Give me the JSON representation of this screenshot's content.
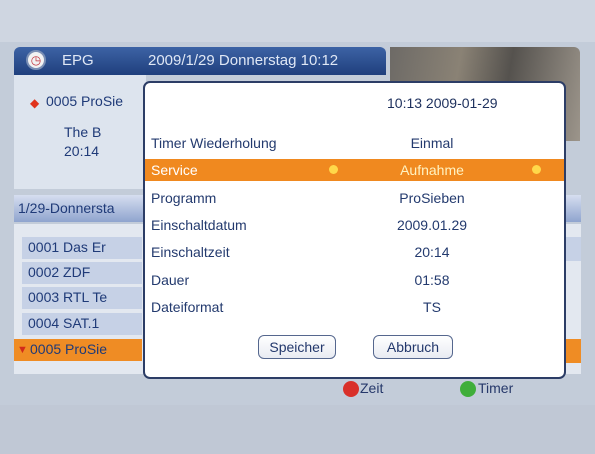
{
  "epg": {
    "title": "EPG",
    "datetime": "2009/1/29 Donnerstag 10:12",
    "icon": "clock-icon"
  },
  "info": {
    "channel": "0005 ProSie",
    "title": "The B",
    "time": "20:14"
  },
  "date_bar": {
    "label": "1/29-Donnersta"
  },
  "channels": [
    {
      "label": "0001 Das Er"
    },
    {
      "label": "0002 ZDF"
    },
    {
      "label": "0003 RTL Te"
    },
    {
      "label": "0004 SAT.1"
    },
    {
      "label": "0005 ProSie"
    }
  ],
  "selected_channel_index": 4,
  "legend": {
    "red_label": "Zeit",
    "green_label": "Timer",
    "red_color": "#d9302a",
    "green_color": "#3fae3a"
  },
  "dialog": {
    "clock": "10:13 2009-01-29",
    "rows": [
      {
        "label": "Timer Wiederholung",
        "value": "Einmal"
      },
      {
        "label": "Service",
        "value": "Aufnahme"
      },
      {
        "label": "Programm",
        "value": "ProSieben"
      },
      {
        "label": "Einschaltdatum",
        "value": "2009.01.29"
      },
      {
        "label": "Einschaltzeit",
        "value": "20:14"
      },
      {
        "label": "Dauer",
        "value": "01:58"
      },
      {
        "label": "Dateiformat",
        "value": "TS"
      }
    ],
    "highlight_row_index": 1,
    "save_label": "Speicher",
    "cancel_label": "Abbruch"
  },
  "colors": {
    "accent": "#f0891f",
    "header": "#2a4c8e"
  }
}
